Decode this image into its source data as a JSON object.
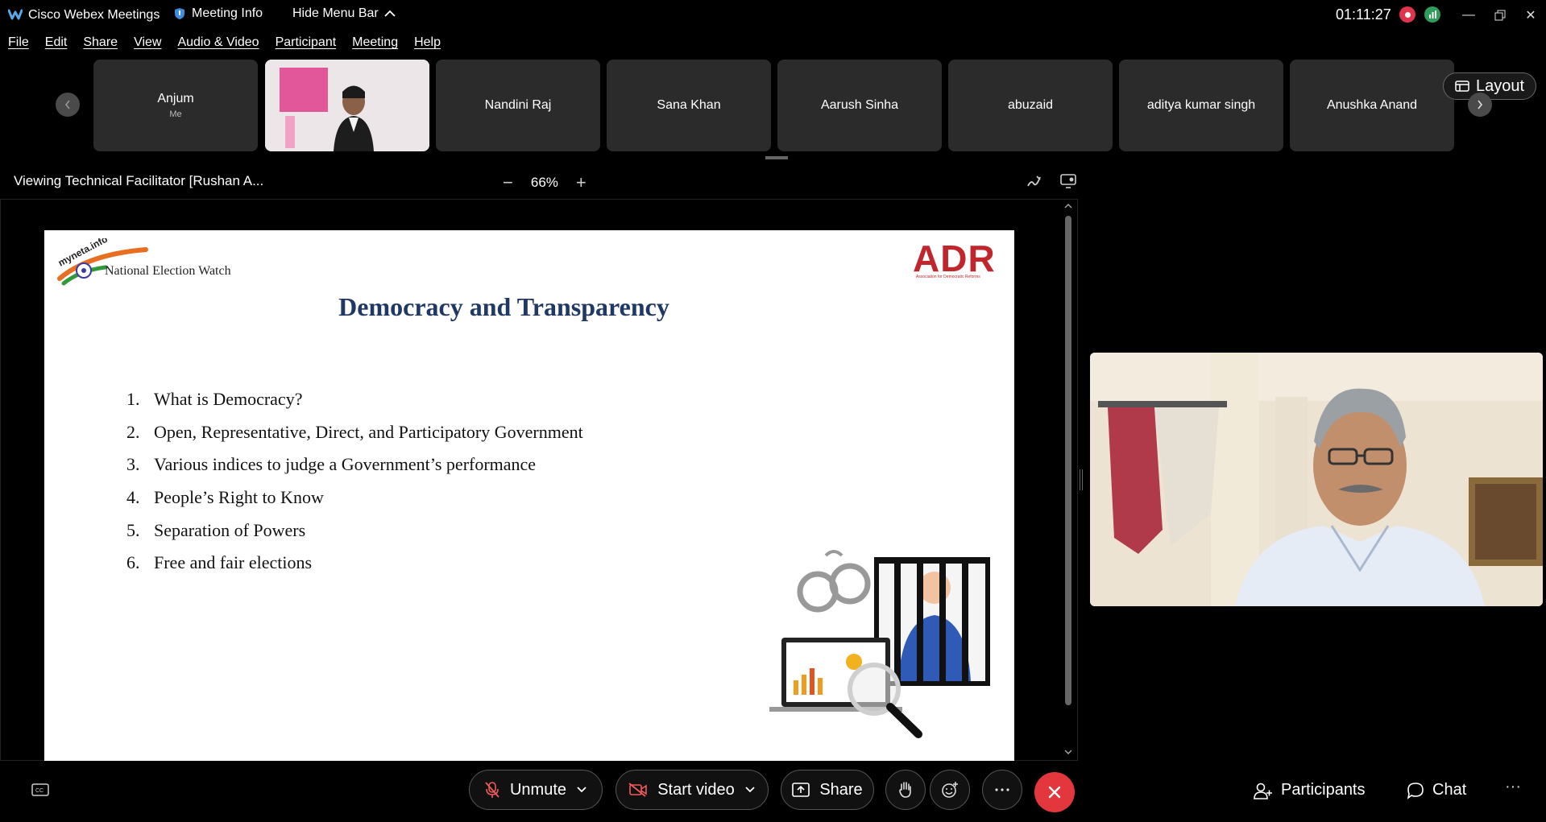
{
  "titlebar": {
    "app_title": "Cisco Webex Meetings",
    "meeting_info": "Meeting Info",
    "hide_menu": "Hide Menu Bar",
    "time": "01:11:27"
  },
  "menu": [
    "File",
    "Edit",
    "Share",
    "View",
    "Audio & Video",
    "Participant",
    "Meeting",
    "Help"
  ],
  "participants": [
    {
      "name": "Anjum",
      "sub": "Me"
    },
    {
      "name": "",
      "sub": ""
    },
    {
      "name": "Nandini Raj",
      "sub": ""
    },
    {
      "name": "Sana Khan",
      "sub": ""
    },
    {
      "name": "Aarush Sinha",
      "sub": ""
    },
    {
      "name": "abuzaid",
      "sub": ""
    },
    {
      "name": "aditya kumar singh",
      "sub": ""
    },
    {
      "name": "Anushka Anand",
      "sub": ""
    }
  ],
  "layout_label": "Layout",
  "viewbar": {
    "viewing": "Viewing Technical Facilitator [Rushan A...",
    "zoom": "66%"
  },
  "slide": {
    "title": "Democracy and Transparency",
    "logo_left_text": "National Election Watch",
    "logo_right": "ADR",
    "logo_right_sub": "Association for Democratic Reforms",
    "items": [
      {
        "n": "1.",
        "text": "What is Democracy?"
      },
      {
        "n": "2.",
        "text": "Open, Representative, Direct, and Participatory Government"
      },
      {
        "n": "3.",
        "text": "Various indices to judge a Government’s performance"
      },
      {
        "n": "4.",
        "text": "People’s Right to Know"
      },
      {
        "n": "5.",
        "text": "Separation of Powers"
      },
      {
        "n": "6.",
        "text": "Free and fair elections"
      }
    ]
  },
  "controls": {
    "unmute": "Unmute",
    "start_video": "Start video",
    "share": "Share",
    "participants": "Participants",
    "chat": "Chat"
  },
  "colors": {
    "end_call": "#e3363d",
    "slide_title": "#1f3864",
    "adr_red": "#c0272d"
  }
}
